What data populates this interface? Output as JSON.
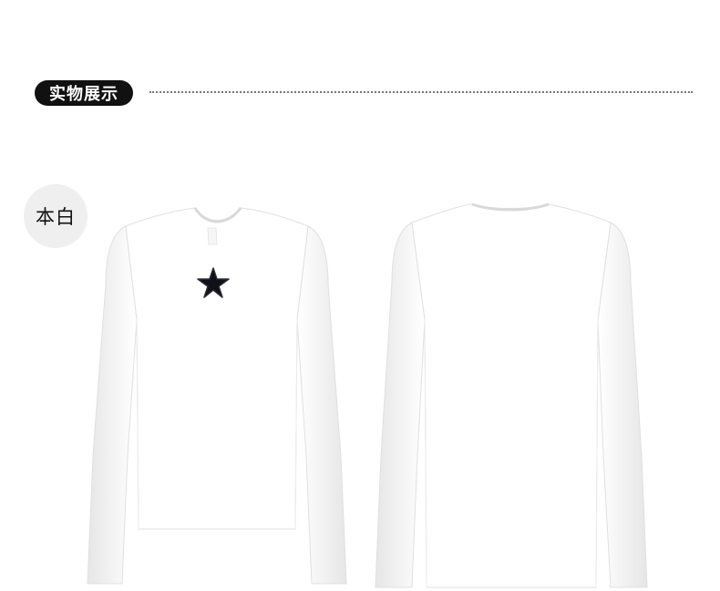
{
  "section": {
    "title": "实物展示"
  },
  "color_label": "本白",
  "views": [
    {
      "name": "front",
      "has_star_appliqué": true
    },
    {
      "name": "back",
      "has_star_appliqué": false
    }
  ],
  "colors": {
    "garment": "#ffffff",
    "garment_shadow": "#e2e2e2",
    "star": "#0f1018",
    "badge_bg": "#efefef",
    "header_pill": "#111111"
  }
}
